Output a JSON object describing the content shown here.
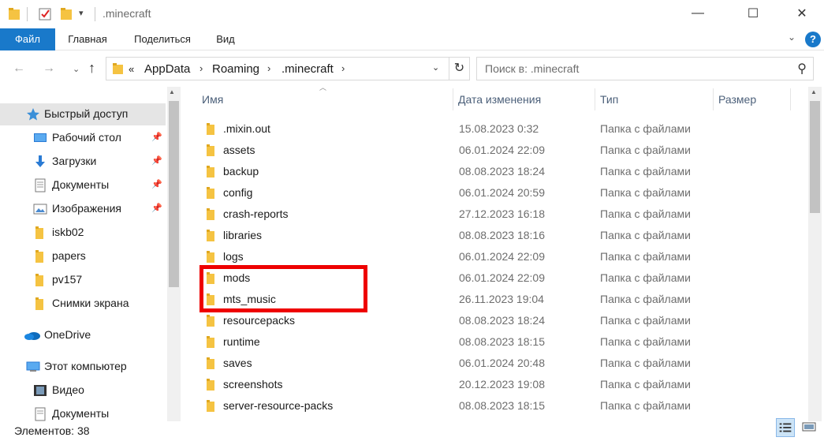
{
  "window": {
    "title": ".minecraft",
    "minimize_glyph": "—",
    "maximize_glyph": "☐",
    "close_glyph": "✕"
  },
  "ribbon": {
    "tabs": [
      "Файл",
      "Главная",
      "Поделиться",
      "Вид"
    ],
    "help_glyph": "?",
    "collapse_glyph": "⌄"
  },
  "nav": {
    "back_glyph": "←",
    "forward_glyph": "→",
    "recent_glyph": "⌄",
    "up_glyph": "↑"
  },
  "address": {
    "overflow": "«",
    "parts": [
      "AppData",
      "Roaming",
      ".minecraft"
    ],
    "chevron": "›",
    "dropdown_glyph": "⌄",
    "refresh_glyph": "↻"
  },
  "search": {
    "placeholder": "Поиск в: .minecraft",
    "icon": "search-icon",
    "icon_glyph": "⚲"
  },
  "sidebar": {
    "items": [
      {
        "label": "Быстрый доступ",
        "icon": "star-icon",
        "pinned": false,
        "active": true
      },
      {
        "label": "Рабочий стол",
        "icon": "desktop-icon",
        "pinned": true
      },
      {
        "label": "Загрузки",
        "icon": "downloads-icon",
        "pinned": true
      },
      {
        "label": "Документы",
        "icon": "documents-icon",
        "pinned": true
      },
      {
        "label": "Изображения",
        "icon": "pictures-icon",
        "pinned": true
      },
      {
        "label": "iskb02",
        "icon": "folder-icon",
        "pinned": false
      },
      {
        "label": "papers",
        "icon": "folder-icon",
        "pinned": false
      },
      {
        "label": "pv157",
        "icon": "folder-icon",
        "pinned": false
      },
      {
        "label": "Снимки экрана",
        "icon": "folder-icon",
        "pinned": false
      },
      {
        "label": "OneDrive",
        "icon": "onedrive-icon",
        "pinned": false
      },
      {
        "label": "Этот компьютер",
        "icon": "computer-icon",
        "pinned": false
      },
      {
        "label": "Видео",
        "icon": "video-icon",
        "pinned": false
      },
      {
        "label": "Документы",
        "icon": "documents-icon",
        "pinned": false
      }
    ]
  },
  "columns": {
    "name": "Имя",
    "date": "Дата изменения",
    "type": "Тип",
    "size": "Размер"
  },
  "files": [
    {
      "name": ".mixin.out",
      "date": "15.08.2023 0:32",
      "type": "Папка с файлами"
    },
    {
      "name": "assets",
      "date": "06.01.2024 22:09",
      "type": "Папка с файлами"
    },
    {
      "name": "backup",
      "date": "08.08.2023 18:24",
      "type": "Папка с файлами"
    },
    {
      "name": "config",
      "date": "06.01.2024 20:59",
      "type": "Папка с файлами"
    },
    {
      "name": "crash-reports",
      "date": "27.12.2023 16:18",
      "type": "Папка с файлами"
    },
    {
      "name": "libraries",
      "date": "08.08.2023 18:16",
      "type": "Папка с файлами"
    },
    {
      "name": "logs",
      "date": "06.01.2024 22:09",
      "type": "Папка с файлами"
    },
    {
      "name": "mods",
      "date": "06.01.2024 22:09",
      "type": "Папка с файлами"
    },
    {
      "name": "mts_music",
      "date": "26.11.2023 19:04",
      "type": "Папка с файлами"
    },
    {
      "name": "resourcepacks",
      "date": "08.08.2023 18:24",
      "type": "Папка с файлами"
    },
    {
      "name": "runtime",
      "date": "08.08.2023 18:15",
      "type": "Папка с файлами"
    },
    {
      "name": "saves",
      "date": "06.01.2024 20:48",
      "type": "Папка с файлами"
    },
    {
      "name": "screenshots",
      "date": "20.12.2023 19:08",
      "type": "Папка с файлами"
    },
    {
      "name": "server-resource-packs",
      "date": "08.08.2023 18:15",
      "type": "Папка с файлами"
    }
  ],
  "status": {
    "items_count": "Элементов: 38"
  },
  "colors": {
    "accent": "#1979ca",
    "folder": "#f5c342",
    "highlight": "#ee0000"
  }
}
